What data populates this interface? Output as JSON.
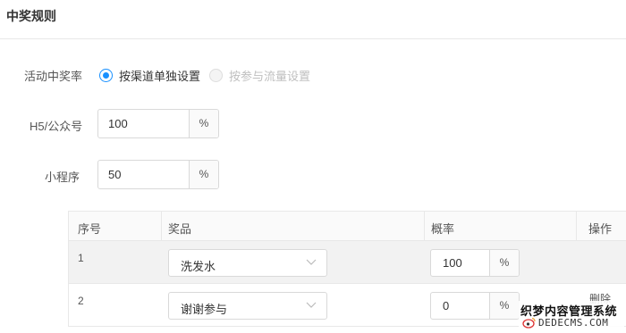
{
  "page": {
    "title": "中奖规则"
  },
  "win_rate": {
    "label": "活动中奖率",
    "options": [
      {
        "label": "按渠道单独设置",
        "checked": true,
        "disabled": false
      },
      {
        "label": "按参与流量设置",
        "checked": false,
        "disabled": true
      }
    ]
  },
  "h5": {
    "label": "H5/公众号",
    "value": "100",
    "unit": "%"
  },
  "miniprogram": {
    "label": "小程序",
    "value": "50",
    "unit": "%"
  },
  "prize_table": {
    "headers": {
      "index": "序号",
      "prize": "奖品",
      "rate": "概率",
      "action": "操作"
    },
    "rows": [
      {
        "index": "1",
        "prize": "洗发水",
        "rate": "100",
        "unit": "%",
        "action": ""
      },
      {
        "index": "2",
        "prize": "谢谢参与",
        "rate": "0",
        "unit": "%",
        "action": "删除"
      }
    ]
  },
  "watermark": {
    "line1": "织梦内容管理系统",
    "line2": "DEDECMS.COM"
  },
  "colors": {
    "accent": "#1890ff",
    "border": "#d9d9d9",
    "header_bg": "#fafafa"
  }
}
